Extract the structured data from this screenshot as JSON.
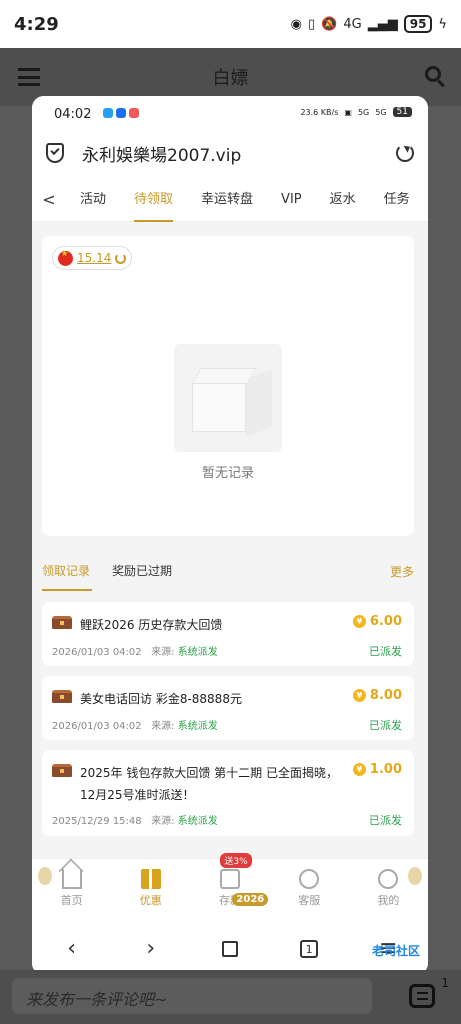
{
  "outer": {
    "time": "4:29",
    "network": "4G",
    "battery": "95",
    "title": "白嫖",
    "comment_placeholder": "来发布一条评论吧~",
    "comment_count": "1"
  },
  "inner": {
    "time": "04:02",
    "speed": "23.6 KB/s",
    "signal1": "5G",
    "signal2": "5G",
    "battery": "51",
    "url": "永利娛樂場2007.vip"
  },
  "tabs": [
    {
      "label": "活动"
    },
    {
      "label": "待领取"
    },
    {
      "label": "幸运转盘"
    },
    {
      "label": "VIP"
    },
    {
      "label": "返水"
    },
    {
      "label": "任务"
    }
  ],
  "balance": "15.14",
  "empty_text": "暂无记录",
  "subtabs": [
    {
      "label": "领取记录"
    },
    {
      "label": "奖励已过期"
    }
  ],
  "more_label": "更多",
  "records": [
    {
      "title": "鲤跃2026 历史存款大回馈",
      "amount": "6.00",
      "date": "2026/01/03 04:02",
      "source_label": "来源:",
      "source": "系统派发",
      "status": "已派发"
    },
    {
      "title": "美女电话回访 彩金8-88888元",
      "amount": "8.00",
      "date": "2026/01/03 04:02",
      "source_label": "来源:",
      "source": "系统派发",
      "status": "已派发"
    },
    {
      "title": "2025年 钱包存款大回馈 第十二期 已全面揭晓，12月25号准时派送！",
      "amount": "1.00",
      "date": "2025/12/29 15:48",
      "source_label": "来源:",
      "source": "系统派发",
      "status": "已派发"
    }
  ],
  "bottom_nav": [
    {
      "label": "首页"
    },
    {
      "label": "优惠"
    },
    {
      "label": "存款"
    },
    {
      "label": "客服"
    },
    {
      "label": "我的"
    }
  ],
  "deposit_badge": "送3%",
  "year_badge": "2026",
  "browser": {
    "tab_count": "1",
    "watermark": "老司社区"
  },
  "colors": {
    "accent": "#c89a2b",
    "success": "#2aa24b",
    "amount": "#e0a91c"
  }
}
